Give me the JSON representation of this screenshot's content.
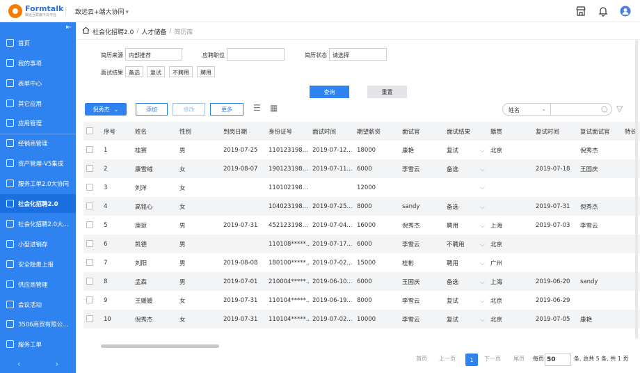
{
  "brand": {
    "name": "Formtalk",
    "sub": "致远互联旗下云平台"
  },
  "org": {
    "name": "致远云+端大协同"
  },
  "sidebar": {
    "items": [
      {
        "label": "首页"
      },
      {
        "label": "我的事项"
      },
      {
        "label": "表单中心"
      },
      {
        "label": "其它应用"
      },
      {
        "label": "应用管理"
      },
      {
        "label": "经销商管理"
      },
      {
        "label": "资产管理-V5集成"
      },
      {
        "label": "服务工单2.0大协同"
      },
      {
        "label": "社会化招聘2.0"
      },
      {
        "label": "社会化招聘2.0大..."
      },
      {
        "label": "小型进销存"
      },
      {
        "label": "安全隐患上报"
      },
      {
        "label": "供应商管理"
      },
      {
        "label": "会议活动"
      },
      {
        "label": "3506商贸有限公..."
      },
      {
        "label": "服务工单"
      }
    ]
  },
  "breadcrumb": {
    "a": "社会化招聘2.0",
    "b": "人才储备",
    "c": "简历库",
    "sep": "/"
  },
  "filters": {
    "source_label": "简历来源",
    "source_value": "内部推荐",
    "position_label": "应聘职位",
    "position_value": "",
    "status_label": "简历状态",
    "status_value": "请选择",
    "result_label": "面试结果",
    "result_tags": [
      "备选",
      "复试",
      "不聘用",
      "聘用"
    ]
  },
  "actions": {
    "query": "查询",
    "reset": "重置",
    "user": "倪秀杰",
    "add": "添加",
    "edit": "修改",
    "more": "更多"
  },
  "search": {
    "field": "姓名"
  },
  "table": {
    "headers": [
      "序号",
      "姓名",
      "性别",
      "到岗日期",
      "身份证号",
      "面试时间",
      "期望薪资",
      "面试官",
      "面试结果",
      "籍贯",
      "复试时间",
      "复试面试官",
      "特长"
    ],
    "rows": [
      [
        "1",
        "桂赛",
        "男",
        "2019-07-25",
        "110123198...",
        "2019-07-12...",
        "18000",
        "康艳",
        "复试",
        "北京",
        "",
        "倪秀杰"
      ],
      [
        "2",
        "康雪绒",
        "女",
        "2019-08-07",
        "190123198...",
        "2019-07-11...",
        "6000",
        "李雪云",
        "备选",
        "",
        "2019-07-18",
        "王国庆"
      ],
      [
        "3",
        "刘洋",
        "女",
        "",
        "110102198...",
        "",
        "12000",
        "",
        "",
        "",
        "",
        ""
      ],
      [
        "4",
        "高铭心",
        "女",
        "",
        "104023198...",
        "2019-07-25...",
        "8000",
        "sandy",
        "备选",
        "",
        "2019-07-31",
        "倪秀杰"
      ],
      [
        "5",
        "庚琼",
        "男",
        "2019-07-31",
        "452123198...",
        "2019-07-04...",
        "16000",
        "倪秀杰",
        "聘用",
        "上海",
        "2019-07-03",
        "李雪云"
      ],
      [
        "6",
        "凯德",
        "男",
        "",
        "110108*****...",
        "2019-07-17...",
        "6000",
        "李雪云",
        "不聘用",
        "北京",
        "",
        ""
      ],
      [
        "7",
        "刘阳",
        "男",
        "2019-08-08",
        "180100*****...",
        "2019-07-02...",
        "15000",
        "桂彬",
        "聘用",
        "广州",
        "",
        ""
      ],
      [
        "8",
        "孟森",
        "男",
        "2019-07-01",
        "210004*****...",
        "2019-06-10...",
        "6000",
        "王国庆",
        "备选",
        "上海",
        "2019-06-20",
        "sandy"
      ],
      [
        "9",
        "王媛媛",
        "女",
        "2019-07-31",
        "110104*****...",
        "2019-06-19...",
        "8000",
        "李雪云",
        "复试",
        "北京",
        "2019-06-29",
        ""
      ],
      [
        "10",
        "倪秀杰",
        "女",
        "2019-07-31",
        "110104*****...",
        "2019-07-02...",
        "10000",
        "李雪云",
        "复试",
        "北京",
        "2019-07-05",
        "康艳"
      ]
    ]
  },
  "pager": {
    "first": "首页",
    "prev": "上一页",
    "current": "1",
    "next": "下一页",
    "last": "尾页",
    "per_label": "每页",
    "per_value": "50",
    "summary": "条, 总共 5 条, 共 1 页"
  },
  "colors": {
    "accent": "#2f83f0",
    "sidebar": "#2f83f0"
  }
}
